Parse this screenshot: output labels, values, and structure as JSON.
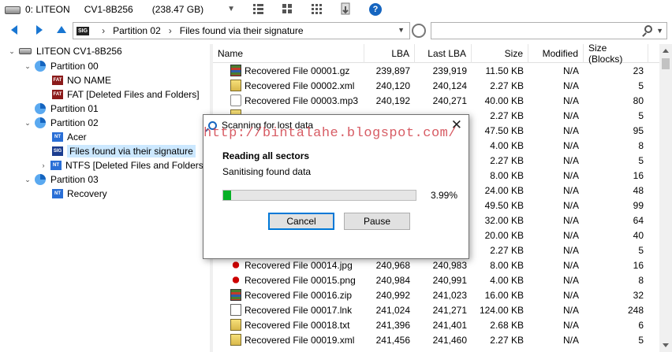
{
  "toolbar": {
    "drive_label": "0: LITEON",
    "drive_model": "CV1-8B256",
    "drive_size": "(238.47 GB)"
  },
  "address": {
    "crumbs": [
      "Partition 02",
      "Files found via their signature"
    ],
    "sig_badge": "SIG"
  },
  "tree": [
    {
      "label": "LITEON CV1-8B256"
    },
    {
      "label": "Partition 00"
    },
    {
      "label": "NO NAME",
      "badge": "FAT"
    },
    {
      "label": "FAT [Deleted Files and Folders]",
      "badge": "FAT"
    },
    {
      "label": "Partition 01"
    },
    {
      "label": "Partition 02"
    },
    {
      "label": "Acer",
      "badge": "NT"
    },
    {
      "label": "Files found via their signature",
      "badge": "SIG"
    },
    {
      "label": "NTFS [Deleted Files and Folders]",
      "badge": "NT"
    },
    {
      "label": "Partition 03"
    },
    {
      "label": "Recovery",
      "badge": "NT"
    }
  ],
  "columns": {
    "name": "Name",
    "lba": "LBA",
    "last_lba": "Last LBA",
    "size": "Size",
    "modified": "Modified",
    "blocks": "Size (Blocks)"
  },
  "files": [
    {
      "name": "Recovered File 00001.gz",
      "lba": "239,897",
      "last": "239,919",
      "size": "11.50 KB",
      "mod": "N/A",
      "blk": "23",
      "type": "archive"
    },
    {
      "name": "Recovered File 00002.xml",
      "lba": "240,120",
      "last": "240,124",
      "size": "2.27 KB",
      "mod": "N/A",
      "blk": "5",
      "type": "text"
    },
    {
      "name": "Recovered File 00003.mp3",
      "lba": "240,192",
      "last": "240,271",
      "size": "40.00 KB",
      "mod": "N/A",
      "blk": "80",
      "type": "media"
    },
    {
      "name": "",
      "lba": "",
      "last": "",
      "size": "2.27 KB",
      "mod": "N/A",
      "blk": "5",
      "type": "text"
    },
    {
      "name": "",
      "lba": "",
      "last": "",
      "size": "47.50 KB",
      "mod": "N/A",
      "blk": "95",
      "type": "doc"
    },
    {
      "name": "",
      "lba": "",
      "last": "",
      "size": "4.00 KB",
      "mod": "N/A",
      "blk": "8",
      "type": "doc"
    },
    {
      "name": "",
      "lba": "",
      "last": "",
      "size": "2.27 KB",
      "mod": "N/A",
      "blk": "5",
      "type": "doc"
    },
    {
      "name": "",
      "lba": "",
      "last": "",
      "size": "8.00 KB",
      "mod": "N/A",
      "blk": "16",
      "type": "doc"
    },
    {
      "name": "",
      "lba": "",
      "last": "",
      "size": "24.00 KB",
      "mod": "N/A",
      "blk": "48",
      "type": "doc"
    },
    {
      "name": "",
      "lba": "",
      "last": "",
      "size": "49.50 KB",
      "mod": "N/A",
      "blk": "99",
      "type": "doc"
    },
    {
      "name": "",
      "lba": "",
      "last": "",
      "size": "32.00 KB",
      "mod": "N/A",
      "blk": "64",
      "type": "doc"
    },
    {
      "name": "",
      "lba": "",
      "last": "",
      "size": "20.00 KB",
      "mod": "N/A",
      "blk": "40",
      "type": "doc"
    },
    {
      "name": "",
      "lba": "",
      "last": "",
      "size": "2.27 KB",
      "mod": "N/A",
      "blk": "5",
      "type": "doc"
    },
    {
      "name": "Recovered File 00014.jpg",
      "lba": "240,968",
      "last": "240,983",
      "size": "8.00 KB",
      "mod": "N/A",
      "blk": "16",
      "type": "image"
    },
    {
      "name": "Recovered File 00015.png",
      "lba": "240,984",
      "last": "240,991",
      "size": "4.00 KB",
      "mod": "N/A",
      "blk": "8",
      "type": "image"
    },
    {
      "name": "Recovered File 00016.zip",
      "lba": "240,992",
      "last": "241,023",
      "size": "16.00 KB",
      "mod": "N/A",
      "blk": "32",
      "type": "archive"
    },
    {
      "name": "Recovered File 00017.lnk",
      "lba": "241,024",
      "last": "241,271",
      "size": "124.00 KB",
      "mod": "N/A",
      "blk": "248",
      "type": "doc"
    },
    {
      "name": "Recovered File 00018.txt",
      "lba": "241,396",
      "last": "241,401",
      "size": "2.68 KB",
      "mod": "N/A",
      "blk": "6",
      "type": "text"
    },
    {
      "name": "Recovered File 00019.xml",
      "lba": "241,456",
      "last": "241,460",
      "size": "2.27 KB",
      "mod": "N/A",
      "blk": "5",
      "type": "text"
    }
  ],
  "dialog": {
    "title": "Scanning for lost data",
    "heading": "Reading all sectors",
    "status": "Sanitising found data",
    "progress_pct": 3.99,
    "progress_label": "3.99%",
    "cancel": "Cancel",
    "pause": "Pause"
  },
  "watermark": "http://bintalahe.blogspot.com/",
  "colors": {
    "accent": "#1976d2",
    "progress": "#06b025",
    "selection": "#cce8ff"
  }
}
